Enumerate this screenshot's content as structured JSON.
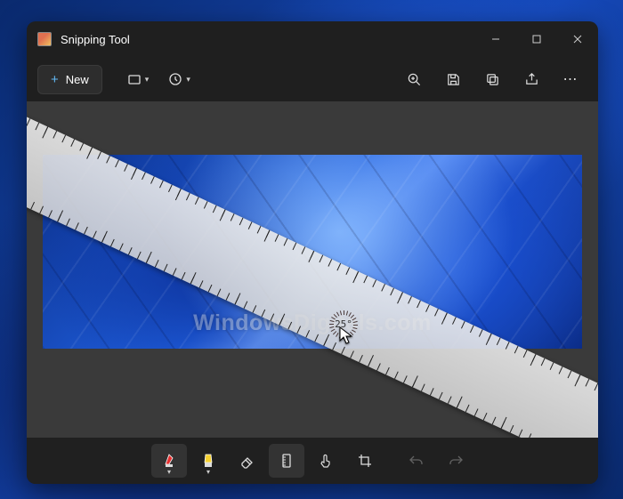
{
  "window": {
    "title": "Snipping Tool"
  },
  "toolbar": {
    "new_label": "New",
    "mode": "rectangle-mode",
    "delay": "delay"
  },
  "actions": {
    "zoom": "zoom",
    "save": "save",
    "copy": "copy",
    "share": "share",
    "more": "more"
  },
  "canvas": {
    "watermark": "WindowsDigitals.com",
    "ruler_angle": "25°"
  },
  "editbar": {
    "pen": "pen-tool",
    "highlighter": "highlighter-tool",
    "eraser": "eraser-tool",
    "ruler": "ruler-tool",
    "touch": "touch-writing",
    "crop": "crop-tool",
    "undo": "undo",
    "redo": "redo"
  }
}
